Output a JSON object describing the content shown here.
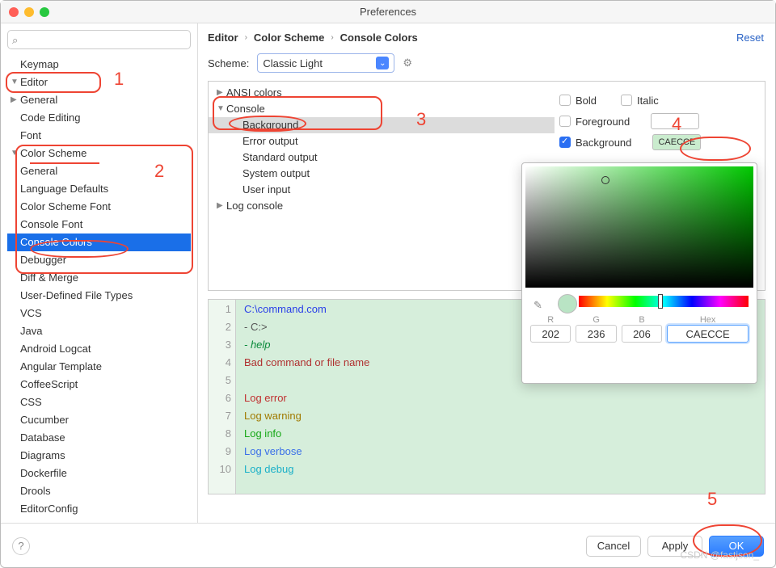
{
  "window": {
    "title": "Preferences"
  },
  "search": {
    "placeholder": ""
  },
  "sidebar": {
    "items": [
      {
        "label": "Keymap",
        "d": 0,
        "caret": ""
      },
      {
        "label": "Editor",
        "d": 0,
        "caret": "▼"
      },
      {
        "label": "General",
        "d": 1,
        "caret": "▶"
      },
      {
        "label": "Code Editing",
        "d": 1,
        "caret": ""
      },
      {
        "label": "Font",
        "d": 1,
        "caret": ""
      },
      {
        "label": "Color Scheme",
        "d": 1,
        "caret": "▼"
      },
      {
        "label": "General",
        "d": 2,
        "caret": ""
      },
      {
        "label": "Language Defaults",
        "d": 2,
        "caret": ""
      },
      {
        "label": "Color Scheme Font",
        "d": 2,
        "caret": ""
      },
      {
        "label": "Console Font",
        "d": 2,
        "caret": ""
      },
      {
        "label": "Console Colors",
        "d": 2,
        "caret": "",
        "selected": true
      },
      {
        "label": "Debugger",
        "d": 2,
        "caret": ""
      },
      {
        "label": "Diff & Merge",
        "d": 2,
        "caret": ""
      },
      {
        "label": "User-Defined File Types",
        "d": 2,
        "caret": ""
      },
      {
        "label": "VCS",
        "d": 2,
        "caret": ""
      },
      {
        "label": "Java",
        "d": 2,
        "caret": ""
      },
      {
        "label": "Android Logcat",
        "d": 2,
        "caret": ""
      },
      {
        "label": "Angular Template",
        "d": 2,
        "caret": ""
      },
      {
        "label": "CoffeeScript",
        "d": 2,
        "caret": ""
      },
      {
        "label": "CSS",
        "d": 2,
        "caret": ""
      },
      {
        "label": "Cucumber",
        "d": 2,
        "caret": ""
      },
      {
        "label": "Database",
        "d": 2,
        "caret": ""
      },
      {
        "label": "Diagrams",
        "d": 2,
        "caret": ""
      },
      {
        "label": "Dockerfile",
        "d": 2,
        "caret": ""
      },
      {
        "label": "Drools",
        "d": 2,
        "caret": ""
      },
      {
        "label": "EditorConfig",
        "d": 2,
        "caret": ""
      }
    ]
  },
  "breadcrumb": [
    "Editor",
    "Color Scheme",
    "Console Colors"
  ],
  "reset": "Reset",
  "scheme": {
    "label": "Scheme:",
    "value": "Classic Light"
  },
  "attrTree": [
    {
      "label": "ANSI colors",
      "caret": "▶",
      "d": 0
    },
    {
      "label": "Console",
      "caret": "▼",
      "d": 0
    },
    {
      "label": "Background",
      "caret": "",
      "d": 1,
      "sel": true
    },
    {
      "label": "Error output",
      "caret": "",
      "d": 1
    },
    {
      "label": "Standard output",
      "caret": "",
      "d": 1
    },
    {
      "label": "System output",
      "caret": "",
      "d": 1
    },
    {
      "label": "User input",
      "caret": "",
      "d": 1
    },
    {
      "label": "Log console",
      "caret": "▶",
      "d": 0
    }
  ],
  "style": {
    "bold": "Bold",
    "italic": "Italic",
    "foreground": "Foreground",
    "background": "Background",
    "bgSwatch": "CAECCE",
    "bgColor": "#CAECCE"
  },
  "preview": [
    {
      "n": "1",
      "t": "C:\\command.com",
      "c": "#2a3fe8"
    },
    {
      "n": "2",
      "t": "- C:>",
      "c": "#555"
    },
    {
      "n": "3",
      "t": "- help",
      "c": "#0a8a3a",
      "i": true
    },
    {
      "n": "4",
      "t": "Bad command or file name",
      "c": "#b03030"
    },
    {
      "n": "5",
      "t": "",
      "c": "#555"
    },
    {
      "n": "6",
      "t": "Log error",
      "c": "#c03030"
    },
    {
      "n": "7",
      "t": "Log warning",
      "c": "#a07a00"
    },
    {
      "n": "8",
      "t": "Log info",
      "c": "#17a817"
    },
    {
      "n": "9",
      "t": "Log verbose",
      "c": "#3a6fe8"
    },
    {
      "n": "10",
      "t": "Log debug",
      "c": "#1bb0c8"
    }
  ],
  "picker": {
    "r": "202",
    "g": "236",
    "b": "206",
    "hex": "CAECCE",
    "labR": "R",
    "labG": "G",
    "labB": "B",
    "labHex": "Hex"
  },
  "footer": {
    "cancel": "Cancel",
    "apply": "Apply",
    "ok": "OK"
  },
  "watermark": "CSDN @fastjson_"
}
